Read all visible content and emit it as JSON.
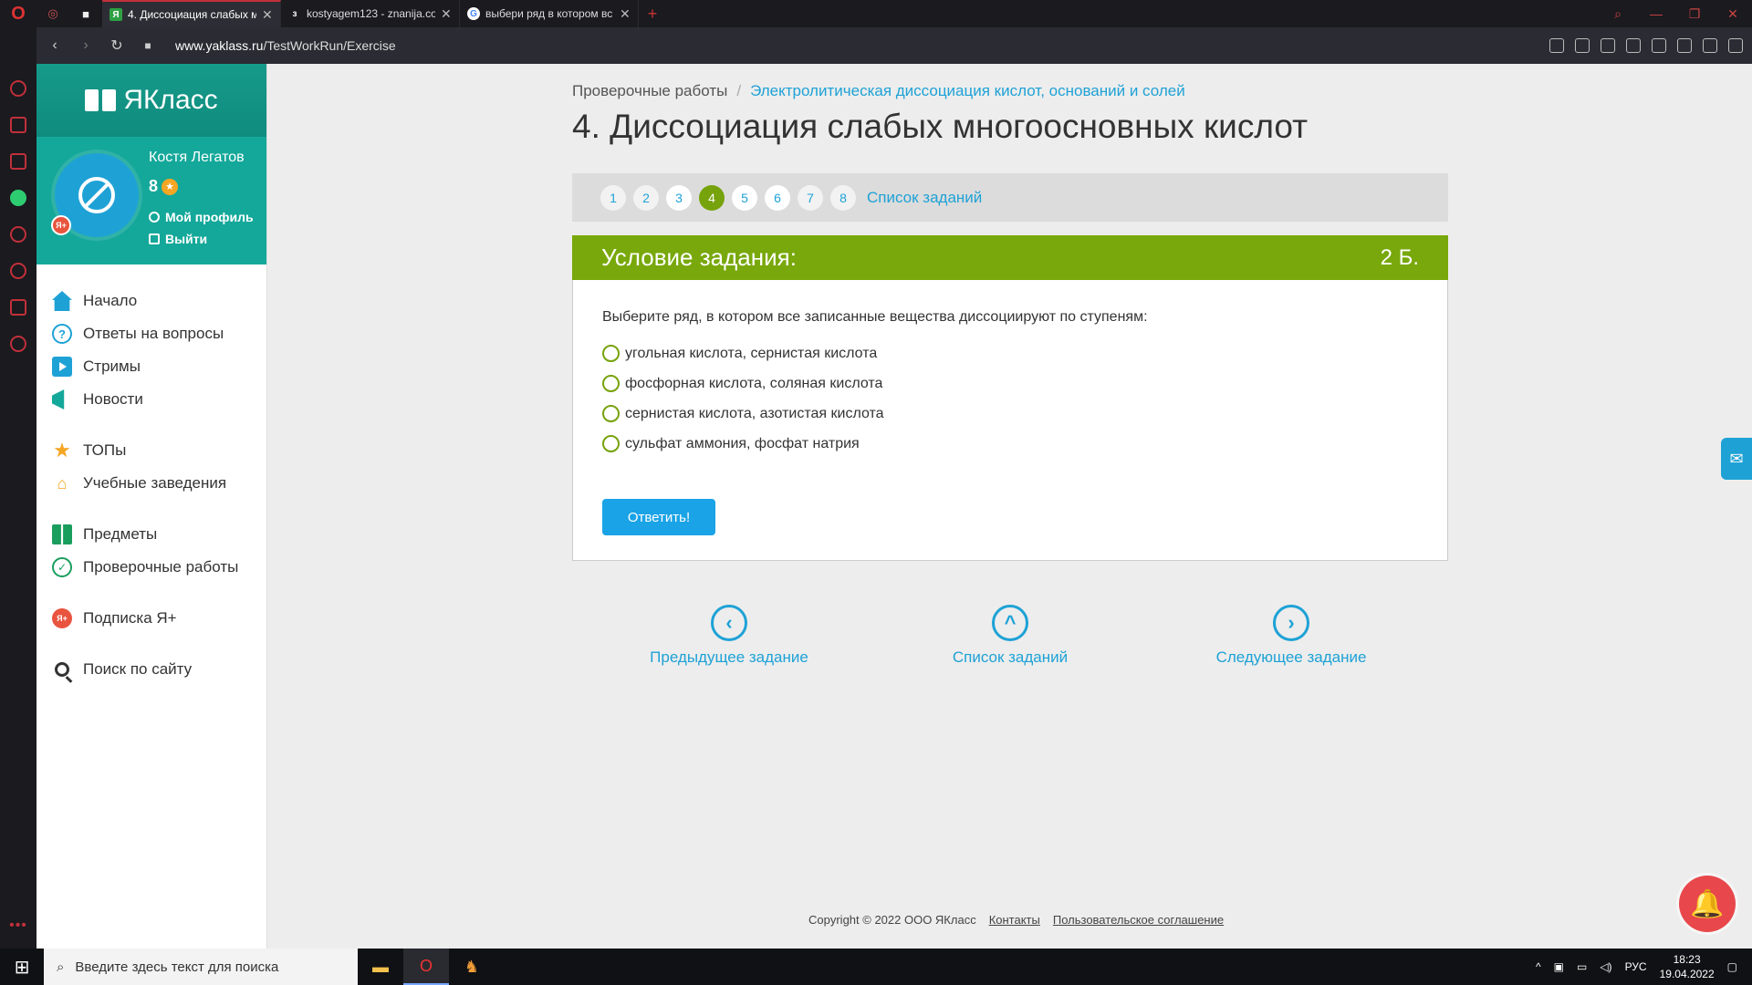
{
  "browser": {
    "tabs": [
      {
        "title": "4. Диссоциация слабых м",
        "active": true
      },
      {
        "title": "kostyagem123 - znanija.co",
        "active": false
      },
      {
        "title": "выбери ряд в котором вс",
        "active": false
      }
    ],
    "url_host": "www.yaklass.ru",
    "url_path": "/TestWorkRun/Exercise"
  },
  "sidebar": {
    "logo": "ЯКласс",
    "profile": {
      "name": "Костя Легатов",
      "points": "8",
      "my_profile": "Мой профиль",
      "logout": "Выйти"
    },
    "items": [
      {
        "label": "Начало",
        "icon": "home-icon"
      },
      {
        "label": "Ответы на вопросы",
        "icon": "question-icon"
      },
      {
        "label": "Стримы",
        "icon": "stream-icon"
      },
      {
        "label": "Новости",
        "icon": "news-icon"
      },
      {
        "label": "ТОПы",
        "icon": "star-icon"
      },
      {
        "label": "Учебные заведения",
        "icon": "school-icon"
      },
      {
        "label": "Предметы",
        "icon": "books-icon"
      },
      {
        "label": "Проверочные работы",
        "icon": "check-icon"
      },
      {
        "label": "Подписка Я+",
        "icon": "ya-plus-icon"
      },
      {
        "label": "Поиск по сайту",
        "icon": "search-icon"
      }
    ]
  },
  "main": {
    "breadcrumb": {
      "root": "Проверочные работы",
      "separator": "/",
      "current": "Электролитическая диссоциация кислот, оснований и солей"
    },
    "title": "4. Диссоциация слабых многоосновных кислот",
    "task_nav": {
      "numbers": [
        "1",
        "2",
        "3",
        "4",
        "5",
        "6",
        "7",
        "8"
      ],
      "current": "4",
      "list_label": "Список заданий"
    },
    "condition": {
      "header": "Условие задания:",
      "points": "2 Б.",
      "question": "Выберите ряд, в котором все записанные вещества диссоциируют по ступеням:",
      "options": [
        "угольная кислота, сернистая кислота",
        "фосфорная кислота, соляная кислота",
        "сернистая кислота, азотистая кислота",
        "сульфат аммония, фосфат натрия"
      ],
      "submit": "Ответить!"
    },
    "bottom_nav": {
      "prev": "Предыдущее задание",
      "list": "Список заданий",
      "next": "Следующее задание"
    }
  },
  "footer": {
    "copyright": "Copyright © 2022 ООО ЯКласс",
    "contacts": "Контакты",
    "agreement": "Пользовательское соглашение"
  },
  "taskbar": {
    "search_placeholder": "Введите здесь текст для поиска",
    "lang": "РУС",
    "time": "18:23",
    "date": "19.04.2022"
  }
}
